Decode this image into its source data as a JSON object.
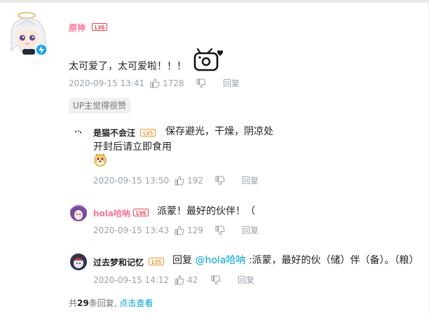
{
  "main_comment": {
    "username": "原神",
    "level": "LV6",
    "text": "太可爱了，太可爱啦！！！",
    "time": "2020-09-15 13:41",
    "likes": "1728",
    "reply_label": "回复",
    "up_tag": "UP主觉得很赞"
  },
  "replies": [
    {
      "username": "是猫不会汪",
      "level": "LV5",
      "text_line1": "保存避光，干燥，阴凉处",
      "text_line2": "开封后请立即食用",
      "time": "2020-09-15 13:50",
      "likes": "192",
      "reply_label": "回复"
    },
    {
      "username": "hola哈呐",
      "level": "LV6",
      "text": "派蒙！最好的伙伴！（",
      "time": "2020-09-15 13:43",
      "likes": "129",
      "reply_label": "回复"
    },
    {
      "username": "过去梦和记忆",
      "level": "LV5",
      "reply_prefix": "回复",
      "mention": "@hola哈呐",
      "text": ":派蒙，最好的伙（储）伴（备）。（粮）",
      "time": "2020-09-15 14:12",
      "likes": "42",
      "reply_label": "回复"
    }
  ],
  "footer": {
    "prefix": "共",
    "count": "29",
    "suffix": "条回复,",
    "link": "点击查看"
  },
  "colors": {
    "vip_name": "#fb7299",
    "level6": "#e8414c",
    "level5": "#f2962e",
    "link": "#00a1d6",
    "meta": "#99a2aa"
  },
  "icons": [
    "thumb-up-icon",
    "thumb-down-icon",
    "verified-badge-icon",
    "tv-emote-icon",
    "doge-emoji-icon"
  ]
}
